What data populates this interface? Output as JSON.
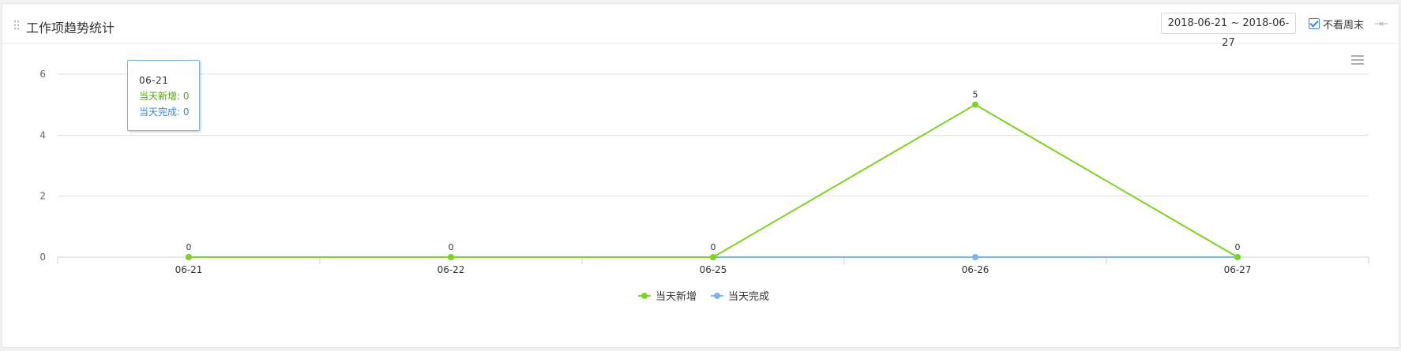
{
  "header": {
    "title": "工作项趋势统计",
    "date_range": "2018-06-21 ~ 2018-06-27",
    "weekend_checkbox_label": "不看周末",
    "weekend_checked": true
  },
  "tooltip": {
    "date": "06-21",
    "new_line": "当天新增: 0",
    "done_line": "当天完成: 0"
  },
  "colors": {
    "new": "#7ed321",
    "done": "#7cb5ec",
    "grid": "#e0e0e0",
    "axis": "#c0d0e0"
  },
  "chart_data": {
    "type": "line",
    "categories": [
      "06-21",
      "06-22",
      "06-25",
      "06-26",
      "06-27"
    ],
    "series": [
      {
        "name": "当天新增",
        "values": [
          0,
          0,
          0,
          5,
          0
        ],
        "color": "#7ed321"
      },
      {
        "name": "当天完成",
        "values": [
          0,
          0,
          0,
          0,
          0
        ],
        "color": "#7cb5ec"
      }
    ],
    "data_labels": [
      "0",
      "0",
      "0",
      "5",
      "0"
    ],
    "ylim": [
      0,
      6
    ],
    "yticks": [
      0,
      2,
      4,
      6
    ],
    "title": "",
    "xlabel": "",
    "ylabel": "",
    "grid": true,
    "legend": "bottom-center"
  }
}
